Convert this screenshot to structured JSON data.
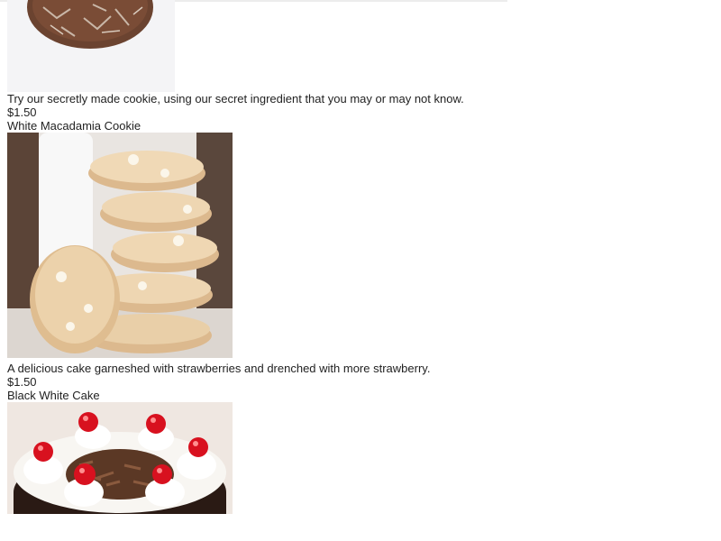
{
  "products": [
    {
      "image_icon": "chocolate-cookie-image",
      "description": "Try our secretly made cookie, using our secret ingredient that you may or may not know.",
      "price": "$1.50"
    },
    {
      "name": "White Macadamia Cookie",
      "image_icon": "white-macadamia-cookie-image",
      "description": "A delicious cake garneshed with strawberries and drenched with more strawberry.",
      "price": "$1.50"
    },
    {
      "name": "Black White Cake",
      "image_icon": "black-forest-cake-image"
    }
  ]
}
